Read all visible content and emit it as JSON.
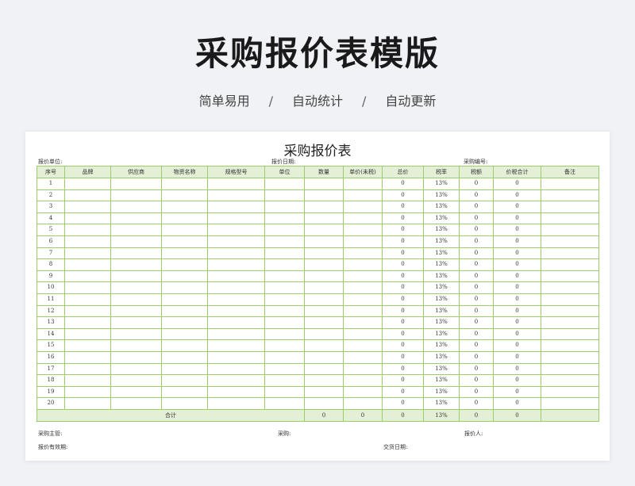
{
  "page": {
    "title": "采购报价表模版",
    "features": [
      "简单易用",
      "自动统计",
      "自动更新"
    ],
    "separator": "/"
  },
  "sheet": {
    "title": "采购报价表",
    "meta": {
      "unit_label": "报价单位:",
      "date_label": "报价日期:",
      "no_label": "采购编号:"
    },
    "columns": [
      "序号",
      "品牌",
      "供应商",
      "物资名称",
      "规格型号",
      "单位",
      "数量",
      "单价(未税)",
      "总价",
      "税率",
      "税额",
      "价税合计",
      "备注"
    ],
    "rows": [
      {
        "no": "1",
        "total": "0",
        "rate": "13%",
        "tax": "0",
        "sum": "0"
      },
      {
        "no": "2",
        "total": "0",
        "rate": "13%",
        "tax": "0",
        "sum": "0"
      },
      {
        "no": "3",
        "total": "0",
        "rate": "13%",
        "tax": "0",
        "sum": "0"
      },
      {
        "no": "4",
        "total": "0",
        "rate": "13%",
        "tax": "0",
        "sum": "0"
      },
      {
        "no": "5",
        "total": "0",
        "rate": "13%",
        "tax": "0",
        "sum": "0"
      },
      {
        "no": "6",
        "total": "0",
        "rate": "13%",
        "tax": "0",
        "sum": "0"
      },
      {
        "no": "7",
        "total": "0",
        "rate": "13%",
        "tax": "0",
        "sum": "0"
      },
      {
        "no": "8",
        "total": "0",
        "rate": "13%",
        "tax": "0",
        "sum": "0"
      },
      {
        "no": "9",
        "total": "0",
        "rate": "13%",
        "tax": "0",
        "sum": "0"
      },
      {
        "no": "10",
        "total": "0",
        "rate": "13%",
        "tax": "0",
        "sum": "0"
      },
      {
        "no": "11",
        "total": "0",
        "rate": "13%",
        "tax": "0",
        "sum": "0"
      },
      {
        "no": "12",
        "total": "0",
        "rate": "13%",
        "tax": "0",
        "sum": "0"
      },
      {
        "no": "13",
        "total": "0",
        "rate": "13%",
        "tax": "0",
        "sum": "0"
      },
      {
        "no": "14",
        "total": "0",
        "rate": "13%",
        "tax": "0",
        "sum": "0"
      },
      {
        "no": "15",
        "total": "0",
        "rate": "13%",
        "tax": "0",
        "sum": "0"
      },
      {
        "no": "16",
        "total": "0",
        "rate": "13%",
        "tax": "0",
        "sum": "0"
      },
      {
        "no": "17",
        "total": "0",
        "rate": "13%",
        "tax": "0",
        "sum": "0"
      },
      {
        "no": "18",
        "total": "0",
        "rate": "13%",
        "tax": "0",
        "sum": "0"
      },
      {
        "no": "19",
        "total": "0",
        "rate": "13%",
        "tax": "0",
        "sum": "0"
      },
      {
        "no": "20",
        "total": "0",
        "rate": "13%",
        "tax": "0",
        "sum": "0"
      }
    ],
    "totals": {
      "label": "合计",
      "qty": "0",
      "unit_price": "0",
      "total": "0",
      "rate": "13%",
      "tax": "0",
      "sum": "0"
    },
    "footer": {
      "manager_label": "采购主管:",
      "buyer_label": "采购:",
      "quoter_label": "报价人:",
      "validity_label": "报价有效期:",
      "delivery_label": "交货日期:"
    }
  },
  "colors": {
    "grid_border": "#8cc63f",
    "header_fill": "#e3f0d5",
    "background": "#f1f2f6"
  }
}
